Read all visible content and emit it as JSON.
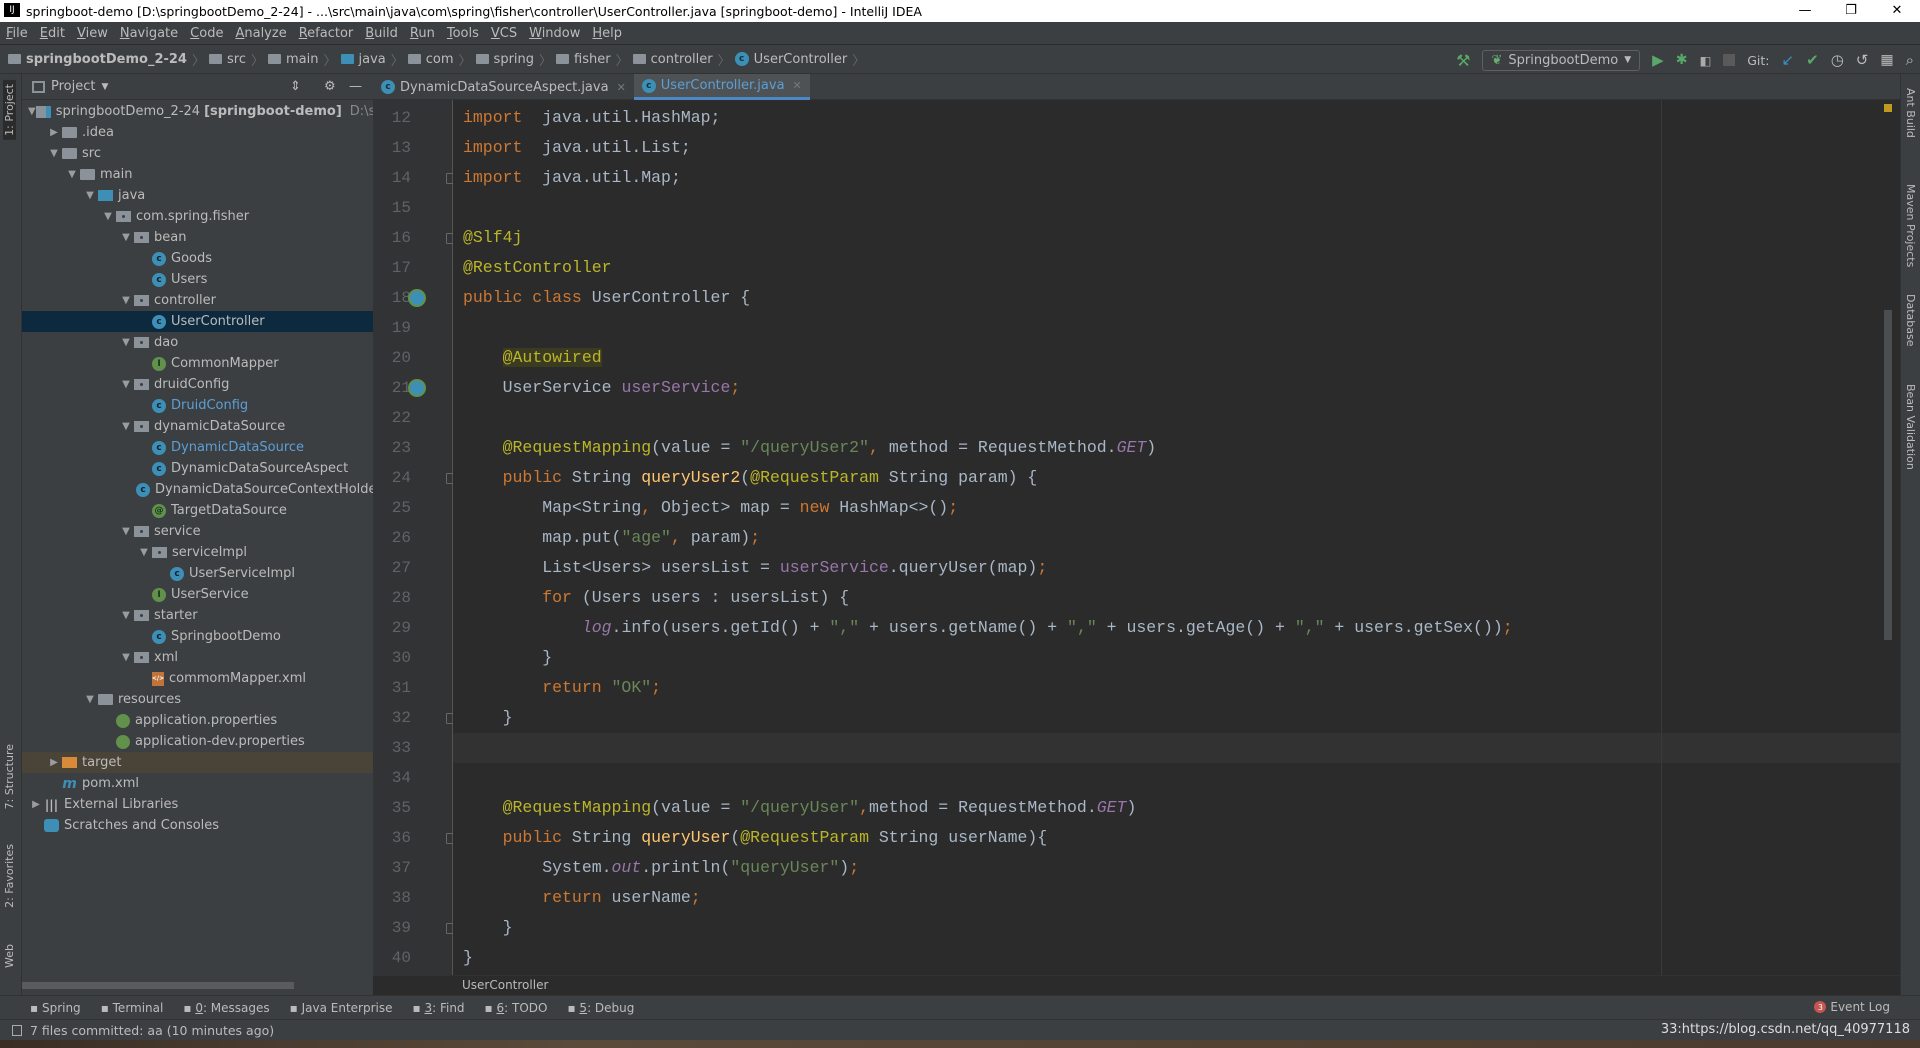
{
  "window": {
    "title": "springboot-demo [D:\\springbootDemo_2-24] - ...\\src\\main\\java\\com\\spring\\fisher\\controller\\UserController.java [springboot-demo] - IntelliJ IDEA",
    "logo": "IJ",
    "controls": [
      "—",
      "❐",
      "✕"
    ]
  },
  "menu": [
    "File",
    "Edit",
    "View",
    "Navigate",
    "Code",
    "Analyze",
    "Refactor",
    "Build",
    "Run",
    "Tools",
    "VCS",
    "Window",
    "Help"
  ],
  "breadcrumbs": [
    "springbootDemo_2-24",
    "src",
    "main",
    "java",
    "com",
    "spring",
    "fisher",
    "controller",
    "UserController"
  ],
  "toolbar": {
    "run_config": "SpringbootDemo",
    "git_label": "Git:"
  },
  "left_stripe": [
    "1: Project",
    "7: Structure",
    "2: Favorites",
    "Web"
  ],
  "right_stripe": [
    "Ant Build",
    "Maven Projects",
    "Database",
    "Bean Validation"
  ],
  "project_panel": {
    "title": "Project",
    "tree": [
      {
        "d": 0,
        "a": "open",
        "i": "module",
        "t": "springbootDemo_2-24",
        "b": "[springboot-demo]",
        "g": "D:\\spring"
      },
      {
        "d": 1,
        "a": "closed",
        "i": "folder",
        "t": ".idea"
      },
      {
        "d": 1,
        "a": "open",
        "i": "folder",
        "t": "src"
      },
      {
        "d": 2,
        "a": "open",
        "i": "folder",
        "t": "main"
      },
      {
        "d": 3,
        "a": "open",
        "i": "folder-blue",
        "t": "java"
      },
      {
        "d": 4,
        "a": "open",
        "i": "package",
        "t": "com.spring.fisher"
      },
      {
        "d": 5,
        "a": "open",
        "i": "package",
        "t": "bean"
      },
      {
        "d": 6,
        "i": "class",
        "t": "Goods"
      },
      {
        "d": 6,
        "i": "class",
        "t": "Users"
      },
      {
        "d": 5,
        "a": "open",
        "i": "package",
        "t": "controller"
      },
      {
        "d": 6,
        "i": "class",
        "t": "UserController",
        "sel": true
      },
      {
        "d": 5,
        "a": "open",
        "i": "package",
        "t": "dao"
      },
      {
        "d": 6,
        "i": "interface",
        "t": "CommonMapper"
      },
      {
        "d": 5,
        "a": "open",
        "i": "package",
        "t": "druidConfig"
      },
      {
        "d": 6,
        "i": "class",
        "t": "DruidConfig",
        "blue": true
      },
      {
        "d": 5,
        "a": "open",
        "i": "package",
        "t": "dynamicDataSource"
      },
      {
        "d": 6,
        "i": "class",
        "t": "DynamicDataSource",
        "blue": true
      },
      {
        "d": 6,
        "i": "class",
        "t": "DynamicDataSourceAspect"
      },
      {
        "d": 6,
        "i": "class",
        "t": "DynamicDataSourceContextHolder"
      },
      {
        "d": 6,
        "i": "annotation",
        "t": "TargetDataSource"
      },
      {
        "d": 5,
        "a": "open",
        "i": "package",
        "t": "service"
      },
      {
        "d": 6,
        "a": "open",
        "i": "package",
        "t": "serviceImpl"
      },
      {
        "d": 7,
        "i": "class",
        "t": "UserServiceImpl"
      },
      {
        "d": 6,
        "i": "interface",
        "t": "UserService"
      },
      {
        "d": 5,
        "a": "open",
        "i": "package",
        "t": "starter"
      },
      {
        "d": 6,
        "i": "class",
        "t": "SpringbootDemo"
      },
      {
        "d": 5,
        "a": "open",
        "i": "package",
        "t": "xml"
      },
      {
        "d": 6,
        "i": "xml",
        "t": "commomMapper.xml"
      },
      {
        "d": 3,
        "a": "open",
        "i": "folder",
        "t": "resources"
      },
      {
        "d": 4,
        "i": "props",
        "t": "application.properties"
      },
      {
        "d": 4,
        "i": "props",
        "t": "application-dev.properties"
      },
      {
        "d": 1,
        "a": "closed",
        "i": "folder-orange",
        "t": "target",
        "ex": true
      },
      {
        "d": 1,
        "i": "maven",
        "t": "pom.xml"
      },
      {
        "d": 0,
        "a": "closed",
        "i": "libs",
        "t": "External Libraries"
      },
      {
        "d": 0,
        "i": "scratch",
        "t": "Scratches and Consoles"
      }
    ]
  },
  "tabs": [
    {
      "label": "DynamicDataSourceAspect.java",
      "active": false
    },
    {
      "label": "UserController.java",
      "active": true
    }
  ],
  "editor": {
    "current_line": 33,
    "lines": [
      {
        "n": 12,
        "t": [
          [
            "kw",
            "import"
          ],
          [
            "",
            "  java.util.HashMap;"
          ]
        ]
      },
      {
        "n": 13,
        "t": [
          [
            "kw",
            "import"
          ],
          [
            "",
            "  java.util.List;"
          ]
        ]
      },
      {
        "n": 14,
        "t": [
          [
            "kw",
            "import"
          ],
          [
            "",
            "  java.util.Map;"
          ]
        ],
        "fold": true
      },
      {
        "n": 15,
        "t": []
      },
      {
        "n": 16,
        "t": [
          [
            "an",
            "@Slf4j"
          ]
        ],
        "fold": true
      },
      {
        "n": 17,
        "t": [
          [
            "an",
            "@RestController"
          ]
        ]
      },
      {
        "n": 18,
        "t": [
          [
            "kw",
            "public class "
          ],
          [
            "",
            "UserController {"
          ]
        ],
        "gicon": true
      },
      {
        "n": 19,
        "t": []
      },
      {
        "n": 20,
        "t": [
          [
            "",
            "    "
          ],
          [
            "an hl",
            "@Autowired"
          ]
        ]
      },
      {
        "n": 21,
        "t": [
          [
            "",
            "    UserService "
          ],
          [
            "fd",
            "userService"
          ],
          [
            "kw",
            ";"
          ]
        ],
        "gicon": true
      },
      {
        "n": 22,
        "t": []
      },
      {
        "n": 23,
        "t": [
          [
            "",
            "    "
          ],
          [
            "an",
            "@RequestMapping"
          ],
          [
            "",
            "(value = "
          ],
          [
            "st",
            "\"/queryUser2\""
          ],
          [
            "kw",
            ", "
          ],
          [
            "",
            "method = RequestMethod."
          ],
          [
            "sf",
            "GET"
          ],
          [
            "",
            ")"
          ]
        ]
      },
      {
        "n": 24,
        "t": [
          [
            "",
            "    "
          ],
          [
            "kw",
            "public "
          ],
          [
            "",
            "String "
          ],
          [
            "fn",
            "queryUser2"
          ],
          [
            "",
            "("
          ],
          [
            "an",
            "@RequestParam "
          ],
          [
            "",
            "String param) {"
          ]
        ],
        "fold": true
      },
      {
        "n": 25,
        "t": [
          [
            "",
            "        Map<String"
          ],
          [
            "kw",
            ", "
          ],
          [
            "",
            "Object> map = "
          ],
          [
            "kw",
            "new "
          ],
          [
            "",
            "HashMap<>()"
          ],
          [
            "kw",
            ";"
          ]
        ]
      },
      {
        "n": 26,
        "t": [
          [
            "",
            "        map.put("
          ],
          [
            "st",
            "\"age\""
          ],
          [
            "kw",
            ", "
          ],
          [
            "",
            "param)"
          ],
          [
            "kw",
            ";"
          ]
        ]
      },
      {
        "n": 27,
        "t": [
          [
            "",
            "        List<Users> usersList = "
          ],
          [
            "fd",
            "userService"
          ],
          [
            "",
            ".queryUser(map)"
          ],
          [
            "kw",
            ";"
          ]
        ]
      },
      {
        "n": 28,
        "t": [
          [
            "",
            "        "
          ],
          [
            "kw",
            "for "
          ],
          [
            "",
            "(Users users : usersList) {"
          ]
        ]
      },
      {
        "n": 29,
        "t": [
          [
            "",
            "            "
          ],
          [
            "sf",
            "log"
          ],
          [
            "",
            ".info(users.getId() + "
          ],
          [
            "st",
            "\",\""
          ],
          [
            "",
            " + users.getName() + "
          ],
          [
            "st",
            "\",\""
          ],
          [
            "",
            " + users.getAge() + "
          ],
          [
            "st",
            "\",\""
          ],
          [
            "",
            " + users.getSex())"
          ],
          [
            "kw",
            ";"
          ]
        ]
      },
      {
        "n": 30,
        "t": [
          [
            "",
            "        }"
          ]
        ]
      },
      {
        "n": 31,
        "t": [
          [
            "",
            "        "
          ],
          [
            "kw",
            "return "
          ],
          [
            "st",
            "\"OK\""
          ],
          [
            "kw",
            ";"
          ]
        ]
      },
      {
        "n": 32,
        "t": [
          [
            "",
            "    }"
          ]
        ],
        "fold": true
      },
      {
        "n": 33,
        "t": []
      },
      {
        "n": 34,
        "t": []
      },
      {
        "n": 35,
        "t": [
          [
            "",
            "    "
          ],
          [
            "an",
            "@RequestMapping"
          ],
          [
            "",
            "(value = "
          ],
          [
            "st",
            "\"/queryUser\""
          ],
          [
            "kw",
            ","
          ],
          [
            "",
            "method = RequestMethod."
          ],
          [
            "sf",
            "GET"
          ],
          [
            "",
            ")"
          ]
        ]
      },
      {
        "n": 36,
        "t": [
          [
            "",
            "    "
          ],
          [
            "kw",
            "public "
          ],
          [
            "",
            "String "
          ],
          [
            "fn",
            "queryUser"
          ],
          [
            "",
            "("
          ],
          [
            "an",
            "@RequestParam "
          ],
          [
            "",
            "String userName){"
          ]
        ],
        "fold": true
      },
      {
        "n": 37,
        "t": [
          [
            "",
            "        System."
          ],
          [
            "sf",
            "out"
          ],
          [
            "",
            ".println("
          ],
          [
            "st",
            "\"queryUser\""
          ],
          [
            "",
            ")"
          ],
          [
            "kw",
            ";"
          ]
        ]
      },
      {
        "n": 38,
        "t": [
          [
            "",
            "        "
          ],
          [
            "kw",
            "return "
          ],
          [
            "",
            "userName"
          ],
          [
            "kw",
            ";"
          ]
        ]
      },
      {
        "n": 39,
        "t": [
          [
            "",
            "    }"
          ]
        ],
        "fold": true
      },
      {
        "n": 40,
        "t": [
          [
            "",
            "}"
          ]
        ]
      }
    ]
  },
  "editor_breadcrumb": "UserController",
  "tool_windows": [
    {
      "k": "Spring",
      "u": ""
    },
    {
      "k": "Terminal",
      "u": ""
    },
    {
      "k": ": Messages",
      "u": "0"
    },
    {
      "k": "Java Enterprise",
      "u": ""
    },
    {
      "k": ": Find",
      "u": "3"
    },
    {
      "k": ": TODO",
      "u": "6"
    },
    {
      "k": ": Debug",
      "u": "5"
    }
  ],
  "event_log": {
    "label": "Event Log",
    "count": "3"
  },
  "status": {
    "message": "7 files committed: aa (10 minutes ago)",
    "right": "33:https://blog.csdn.net/qq_40977118"
  },
  "colors": {
    "keyword": "#cc7832",
    "annotation": "#bbb529",
    "string": "#6a8759",
    "field": "#9876aa",
    "text": "#a9b7c6",
    "editor_bg": "#2b2b2b",
    "panel_bg": "#3c3f41",
    "selection": "#0d293e"
  }
}
